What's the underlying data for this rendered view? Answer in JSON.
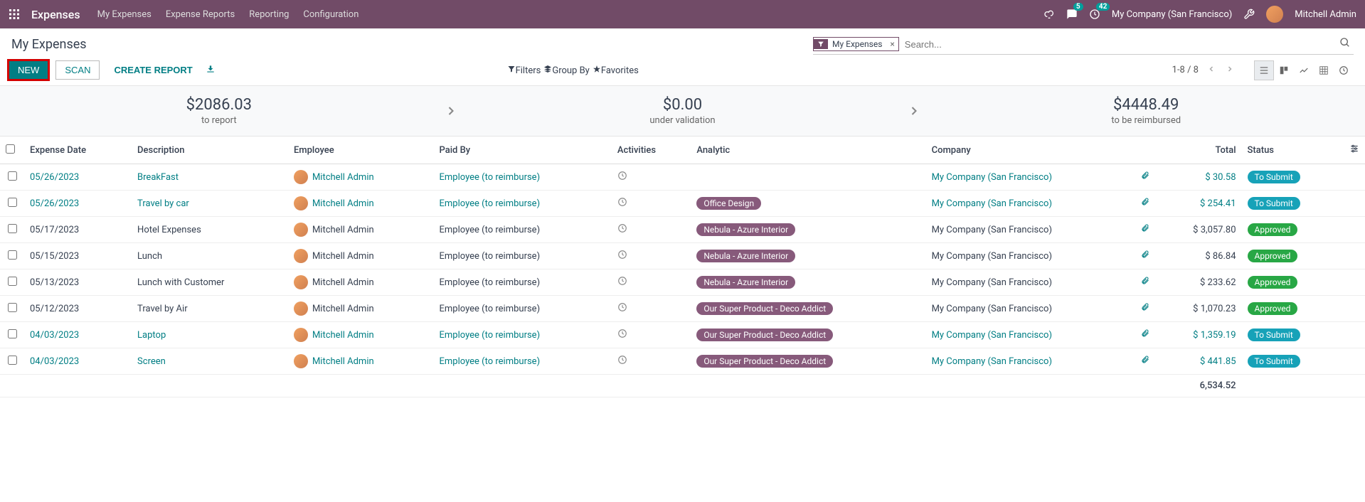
{
  "navbar": {
    "brand": "Expenses",
    "links": [
      "My Expenses",
      "Expense Reports",
      "Reporting",
      "Configuration"
    ],
    "messages_count": "5",
    "activities_count": "42",
    "company": "My Company (San Francisco)",
    "user": "Mitchell Admin"
  },
  "breadcrumb": "My Expenses",
  "search": {
    "chip_label": "My Expenses",
    "placeholder": "Search..."
  },
  "buttons": {
    "new": "NEW",
    "scan": "SCAN",
    "create_report": "CREATE REPORT"
  },
  "search_options": {
    "filters": "Filters",
    "group_by": "Group By",
    "favorites": "Favorites"
  },
  "pager": "1-8 / 8",
  "stats": [
    {
      "amount": "$2086.03",
      "label": "to report"
    },
    {
      "amount": "$0.00",
      "label": "under validation"
    },
    {
      "amount": "$4448.49",
      "label": "to be reimbursed"
    }
  ],
  "columns": {
    "date": "Expense Date",
    "description": "Description",
    "employee": "Employee",
    "paid_by": "Paid By",
    "activities": "Activities",
    "analytic": "Analytic",
    "company": "Company",
    "total": "Total",
    "status": "Status"
  },
  "rows": [
    {
      "date": "05/26/2023",
      "description": "BreakFast",
      "employee": "Mitchell Admin",
      "paid_by": "Employee (to reimburse)",
      "analytic": "",
      "company": "My Company (San Francisco)",
      "total": "$ 30.58",
      "status": "To Submit",
      "status_class": "status-submit",
      "link": true
    },
    {
      "date": "05/26/2023",
      "description": "Travel by car",
      "employee": "Mitchell Admin",
      "paid_by": "Employee (to reimburse)",
      "analytic": "Office Design",
      "company": "My Company (San Francisco)",
      "total": "$ 254.41",
      "status": "To Submit",
      "status_class": "status-submit",
      "link": true
    },
    {
      "date": "05/17/2023",
      "description": "Hotel Expenses",
      "employee": "Mitchell Admin",
      "paid_by": "Employee (to reimburse)",
      "analytic": "Nebula - Azure Interior",
      "company": "My Company (San Francisco)",
      "total": "$ 3,057.80",
      "status": "Approved",
      "status_class": "status-approved",
      "link": false
    },
    {
      "date": "05/15/2023",
      "description": "Lunch",
      "employee": "Mitchell Admin",
      "paid_by": "Employee (to reimburse)",
      "analytic": "Nebula - Azure Interior",
      "company": "My Company (San Francisco)",
      "total": "$ 86.84",
      "status": "Approved",
      "status_class": "status-approved",
      "link": false
    },
    {
      "date": "05/13/2023",
      "description": "Lunch with Customer",
      "employee": "Mitchell Admin",
      "paid_by": "Employee (to reimburse)",
      "analytic": "Nebula - Azure Interior",
      "company": "My Company (San Francisco)",
      "total": "$ 233.62",
      "status": "Approved",
      "status_class": "status-approved",
      "link": false
    },
    {
      "date": "05/12/2023",
      "description": "Travel by Air",
      "employee": "Mitchell Admin",
      "paid_by": "Employee (to reimburse)",
      "analytic": "Our Super Product - Deco Addict",
      "company": "My Company (San Francisco)",
      "total": "$ 1,070.23",
      "status": "Approved",
      "status_class": "status-approved",
      "link": false
    },
    {
      "date": "04/03/2023",
      "description": "Laptop",
      "employee": "Mitchell Admin",
      "paid_by": "Employee (to reimburse)",
      "analytic": "Our Super Product - Deco Addict",
      "company": "My Company (San Francisco)",
      "total": "$ 1,359.19",
      "status": "To Submit",
      "status_class": "status-submit",
      "link": true
    },
    {
      "date": "04/03/2023",
      "description": "Screen",
      "employee": "Mitchell Admin",
      "paid_by": "Employee (to reimburse)",
      "analytic": "Our Super Product - Deco Addict",
      "company": "My Company (San Francisco)",
      "total": "$ 441.85",
      "status": "To Submit",
      "status_class": "status-submit",
      "link": true
    }
  ],
  "footer_total": "6,534.52"
}
